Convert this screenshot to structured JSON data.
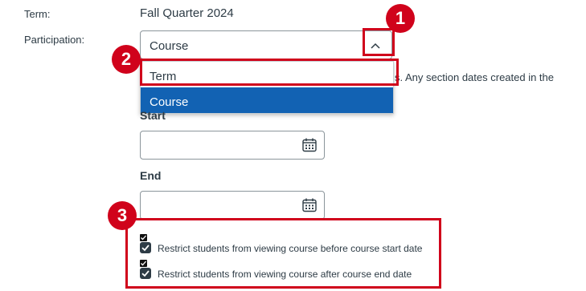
{
  "term": {
    "label": "Term:",
    "value": "Fall Quarter 2024"
  },
  "participation": {
    "label": "Participation:",
    "selected": "Course",
    "options": [
      "Term",
      "Course"
    ],
    "highlighted_option": "Course"
  },
  "hint_text": "s. Any section dates created in the",
  "dates": {
    "start_label": "Start",
    "end_label": "End"
  },
  "restrictions": {
    "before_start": "Restrict students from viewing course before course start date",
    "after_end": "Restrict students from viewing course after course end date"
  },
  "annotations": {
    "badge1": "1",
    "badge2": "2",
    "badge3": "3",
    "color": "#d0021b"
  }
}
